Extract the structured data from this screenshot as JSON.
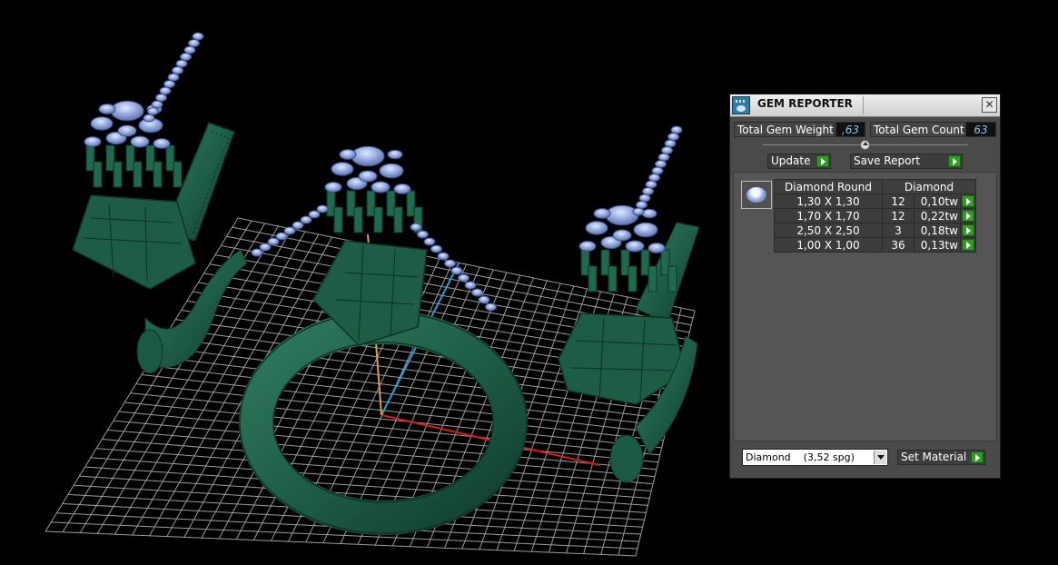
{
  "window": {
    "title": "GEM REPORTER",
    "close_glyph": "✕"
  },
  "summary": {
    "weight_label": "Total Gem Weight",
    "weight_value": ",63",
    "count_label": "Total Gem Count",
    "count_value": "63"
  },
  "buttons": {
    "update": "Update",
    "save_report": "Save Report",
    "set_material": "Set Material"
  },
  "table": {
    "headers": [
      "Diamond Round",
      "Diamond"
    ],
    "rows": [
      {
        "size": "1,30 X 1,30",
        "count": "12",
        "weight": "0,10tw"
      },
      {
        "size": "1,70 X 1,70",
        "count": "12",
        "weight": "0,22tw"
      },
      {
        "size": "2,50 X 2,50",
        "count": "3",
        "weight": "0,18tw"
      },
      {
        "size": "1,00 X 1,00",
        "count": "36",
        "weight": "0,13tw"
      }
    ]
  },
  "material": {
    "selected": "Diamond    (3,52 spg)"
  },
  "colors": {
    "model": "#1f5e48",
    "gem": "#8fa6dc",
    "grid": "#9c9c9c",
    "axis_x": "#d81e12",
    "axis_y": "#2a9ed8",
    "axis_z": "#e0a040",
    "go_button": "#2f9c23"
  },
  "icons": [
    "gem-reporter-app-icon",
    "close-icon",
    "play-arrow-icon",
    "dropdown-arrow-icon",
    "slider-knob-icon",
    "round-diamond-icon"
  ]
}
